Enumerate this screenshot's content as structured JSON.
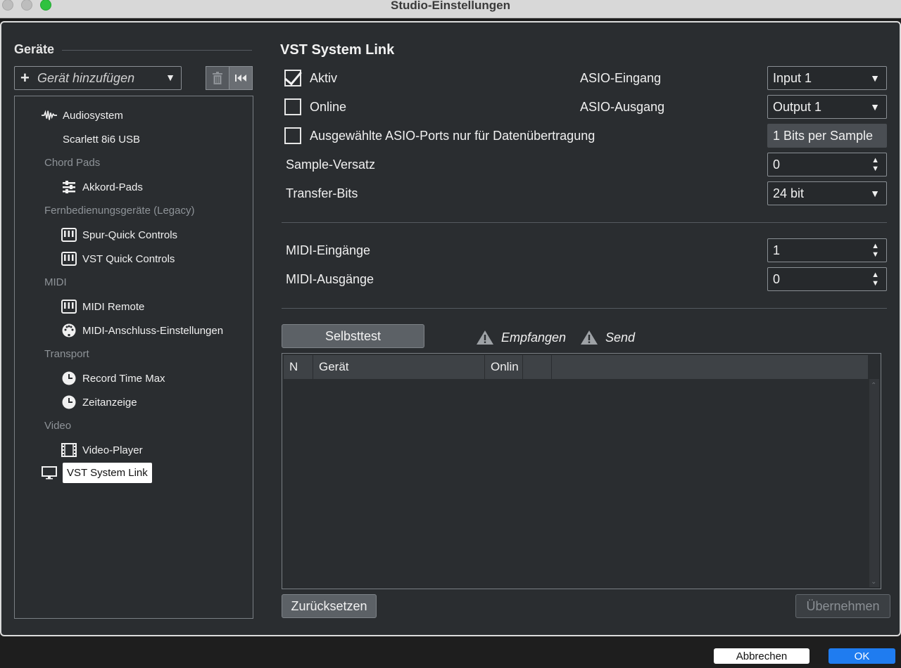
{
  "window": {
    "title": "Studio-Einstellungen"
  },
  "sidebar": {
    "section_title": "Geräte",
    "add_device_label": "Gerät hinzufügen",
    "tree": {
      "audiosystem": "Audiosystem",
      "scarlett": "Scarlett 8i6 USB",
      "cat_chord": "Chord Pads",
      "akkord_pads": "Akkord-Pads",
      "cat_remote": "Fernbedienungsgeräte (Legacy)",
      "spur_qc": "Spur-Quick Controls",
      "vst_qc": "VST Quick Controls",
      "cat_midi": "MIDI",
      "midi_remote": "MIDI Remote",
      "midi_port": "MIDI-Anschluss-Einstellungen",
      "cat_transport": "Transport",
      "record_time": "Record Time Max",
      "zeitanzeige": "Zeitanzeige",
      "cat_video": "Video",
      "video_player": "Video-Player",
      "vst_system_link": "VST System Link"
    }
  },
  "main": {
    "title": "VST System Link",
    "aktiv_label": "Aktiv",
    "online_label": "Online",
    "asio_ports_label": "Ausgewählte ASIO-Ports nur für Datenübertragung",
    "asio_in_label": "ASIO-Eingang",
    "asio_in_value": "Input 1",
    "asio_out_label": "ASIO-Ausgang",
    "asio_out_value": "Output 1",
    "bits_per_sample": "1 Bits per Sample",
    "sample_offset_label": "Sample-Versatz",
    "sample_offset_value": "0",
    "transfer_bits_label": "Transfer-Bits",
    "transfer_bits_value": "24 bit",
    "midi_in_label": "MIDI-Eingänge",
    "midi_in_value": "1",
    "midi_out_label": "MIDI-Ausgänge",
    "midi_out_value": "0",
    "selftest_label": "Selbsttest",
    "receive_label": "Empfangen",
    "send_label": "Send",
    "table_headers": [
      "N",
      "Gerät",
      "Onlin",
      ""
    ],
    "reset_label": "Zurücksetzen",
    "apply_label": "Übernehmen"
  },
  "footer": {
    "cancel_label": "Abbrechen",
    "ok_label": "OK"
  },
  "colors": {
    "accent": "#1f7cf0",
    "panel_bg": "#2a2d30"
  }
}
